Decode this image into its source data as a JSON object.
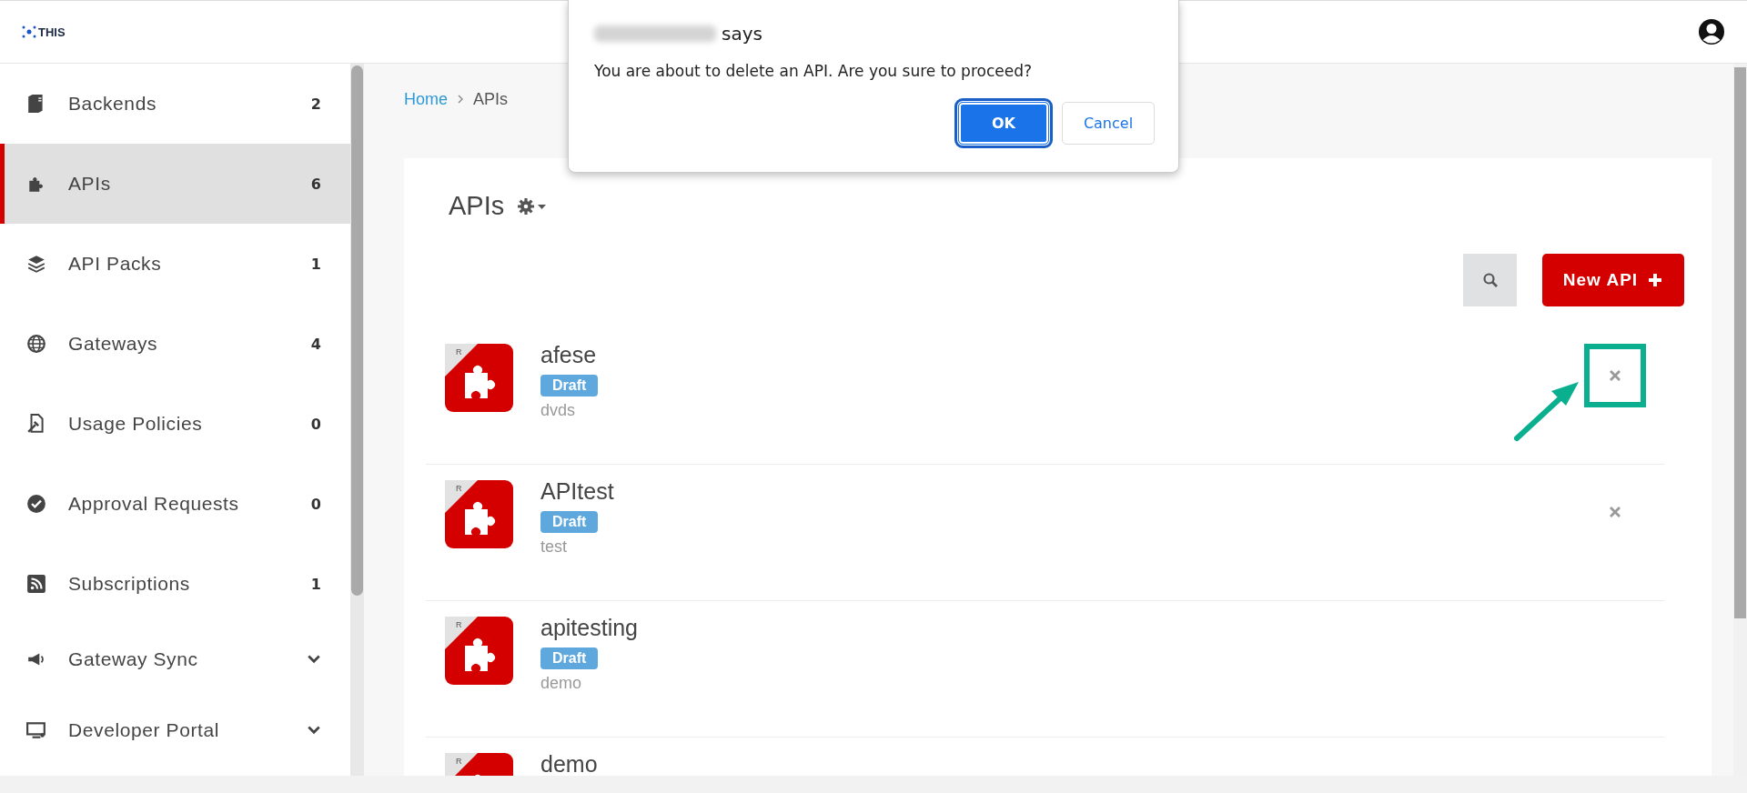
{
  "header": {
    "logo": "THIS"
  },
  "sidebar": {
    "items": [
      {
        "label": "Backends",
        "kind": "count",
        "count": "2",
        "selected": false
      },
      {
        "label": "APIs",
        "kind": "count",
        "count": "6",
        "selected": true
      },
      {
        "label": "API Packs",
        "kind": "count",
        "count": "1",
        "selected": false
      },
      {
        "label": "Gateways",
        "kind": "count",
        "count": "4",
        "selected": false
      },
      {
        "label": "Usage Policies",
        "kind": "count",
        "count": "0",
        "selected": false
      },
      {
        "label": "Approval Requests",
        "kind": "count",
        "count": "0",
        "selected": false
      },
      {
        "label": "Subscriptions",
        "kind": "count",
        "count": "1",
        "selected": false
      },
      {
        "label": "Gateway Sync",
        "kind": "group",
        "expanded": false,
        "selected": false
      },
      {
        "label": "Developer Portal",
        "kind": "group",
        "expanded": false,
        "selected": false
      }
    ]
  },
  "breadcrumb": [
    {
      "label": "Home",
      "kind": "link"
    },
    {
      "label": "APIs",
      "kind": "current"
    }
  ],
  "page": {
    "title": "APIs",
    "new_button": "New API"
  },
  "apis": [
    {
      "badge": "R",
      "name": "afese",
      "status": "Draft",
      "description": "dvds",
      "deletable": true,
      "annotated": true
    },
    {
      "badge": "R",
      "name": "APItest",
      "status": "Draft",
      "description": "test",
      "deletable": true,
      "annotated": false
    },
    {
      "badge": "R",
      "name": "apitesting",
      "status": "Draft",
      "description": "demo",
      "deletable": false,
      "annotated": false
    },
    {
      "badge": "R",
      "name": "demo",
      "deletable": false,
      "annotated": false
    }
  ],
  "dialog": {
    "origin_suffix": "says",
    "message": "You are about to delete an API. Are you sure to proceed?",
    "buttons": [
      {
        "label": "OK",
        "kind": "primary",
        "focused": true
      },
      {
        "label": "Cancel",
        "kind": "secondary",
        "focused": false
      }
    ]
  }
}
